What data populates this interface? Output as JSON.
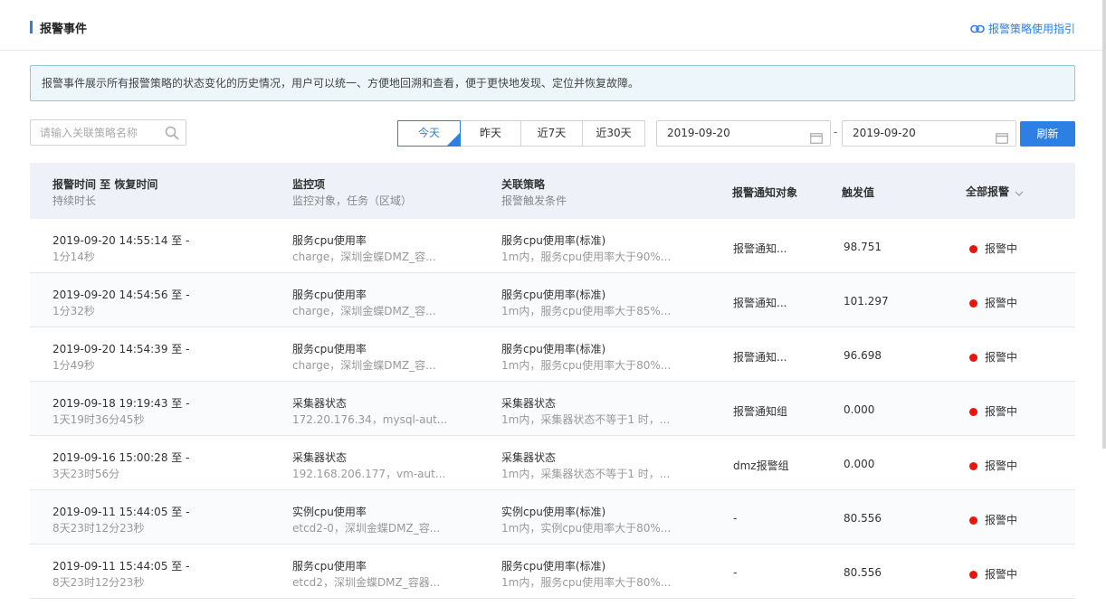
{
  "header": {
    "title": "报警事件",
    "guide_link": "报警策略使用指引"
  },
  "notice": "报警事件展示所有报警策略的状态变化的历史情况，用户可以统一、方便地回溯和查看，便于更快地发现、定位并恢复故障。",
  "search": {
    "placeholder": "请输入关联策略名称"
  },
  "range_tabs": [
    "今天",
    "昨天",
    "近7天",
    "近30天"
  ],
  "date_range": {
    "start": "2019-09-20",
    "separator": "-",
    "end": "2019-09-20"
  },
  "refresh_label": "刷新",
  "table": {
    "headers": {
      "time": "报警时间 至 恢复时间",
      "time_sub": "持续时长",
      "monitor": "监控项",
      "monitor_sub": "监控对象，任务（区域）",
      "policy": "关联策略",
      "policy_sub": "报警触发条件",
      "notify": "报警通知对象",
      "value": "触发值",
      "status": "全部报警"
    },
    "rows": [
      {
        "time": "2019-09-20 14:55:14 至 -",
        "duration": "1分14秒",
        "monitor": "服务cpu使用率",
        "target": "charge，深圳金蝶DMZ_容...",
        "policy": "服务cpu使用率(标准)",
        "condition": "1m内，服务cpu使用率大于90%...",
        "notify": "报警通知...",
        "value": "98.751",
        "status": "报警中"
      },
      {
        "time": "2019-09-20 14:54:56 至 -",
        "duration": "1分32秒",
        "monitor": "服务cpu使用率",
        "target": "charge，深圳金蝶DMZ_容...",
        "policy": "服务cpu使用率(标准)",
        "condition": "1m内，服务cpu使用率大于85%...",
        "notify": "报警通知...",
        "value": "101.297",
        "status": "报警中"
      },
      {
        "time": "2019-09-20 14:54:39 至 -",
        "duration": "1分49秒",
        "monitor": "服务cpu使用率",
        "target": "charge，深圳金蝶DMZ_容...",
        "policy": "服务cpu使用率(标准)",
        "condition": "1m内，服务cpu使用率大于80%...",
        "notify": "报警通知...",
        "value": "96.698",
        "status": "报警中"
      },
      {
        "time": "2019-09-18 19:19:43 至 -",
        "duration": "1天19时36分45秒",
        "monitor": "采集器状态",
        "target": "172.20.176.34，mysql-aut...",
        "policy": "采集器状态",
        "condition": "1m内，采集器状态不等于1 时，...",
        "notify": "报警通知组",
        "value": "0.000",
        "status": "报警中"
      },
      {
        "time": "2019-09-16 15:00:28 至 -",
        "duration": "3天23时56分",
        "monitor": "采集器状态",
        "target": "192.168.206.177，vm-aut...",
        "policy": "采集器状态",
        "condition": "1m内，采集器状态不等于1 时，...",
        "notify": "dmz报警组",
        "value": "0.000",
        "status": "报警中"
      },
      {
        "time": "2019-09-11 15:44:05 至 -",
        "duration": "8天23时12分23秒",
        "monitor": "实例cpu使用率",
        "target": "etcd2-0，深圳金蝶DMZ_容...",
        "policy": "实例cpu使用率(标准)",
        "condition": "1m内，实例cpu使用率大于80%...",
        "notify": "-",
        "value": "80.556",
        "status": "报警中"
      },
      {
        "time": "2019-09-11 15:44:05 至 -",
        "duration": "8天23时12分23秒",
        "monitor": "服务cpu使用率",
        "target": "etcd2，深圳金蝶DMZ_容器...",
        "policy": "服务cpu使用率(标准)",
        "condition": "1m内，服务cpu使用率大于80%...",
        "notify": "-",
        "value": "80.556",
        "status": "报警中"
      }
    ]
  },
  "colors": {
    "accent": "#2c80e4",
    "alert": "#e8140d",
    "notice_bg": "#edf7fb"
  }
}
